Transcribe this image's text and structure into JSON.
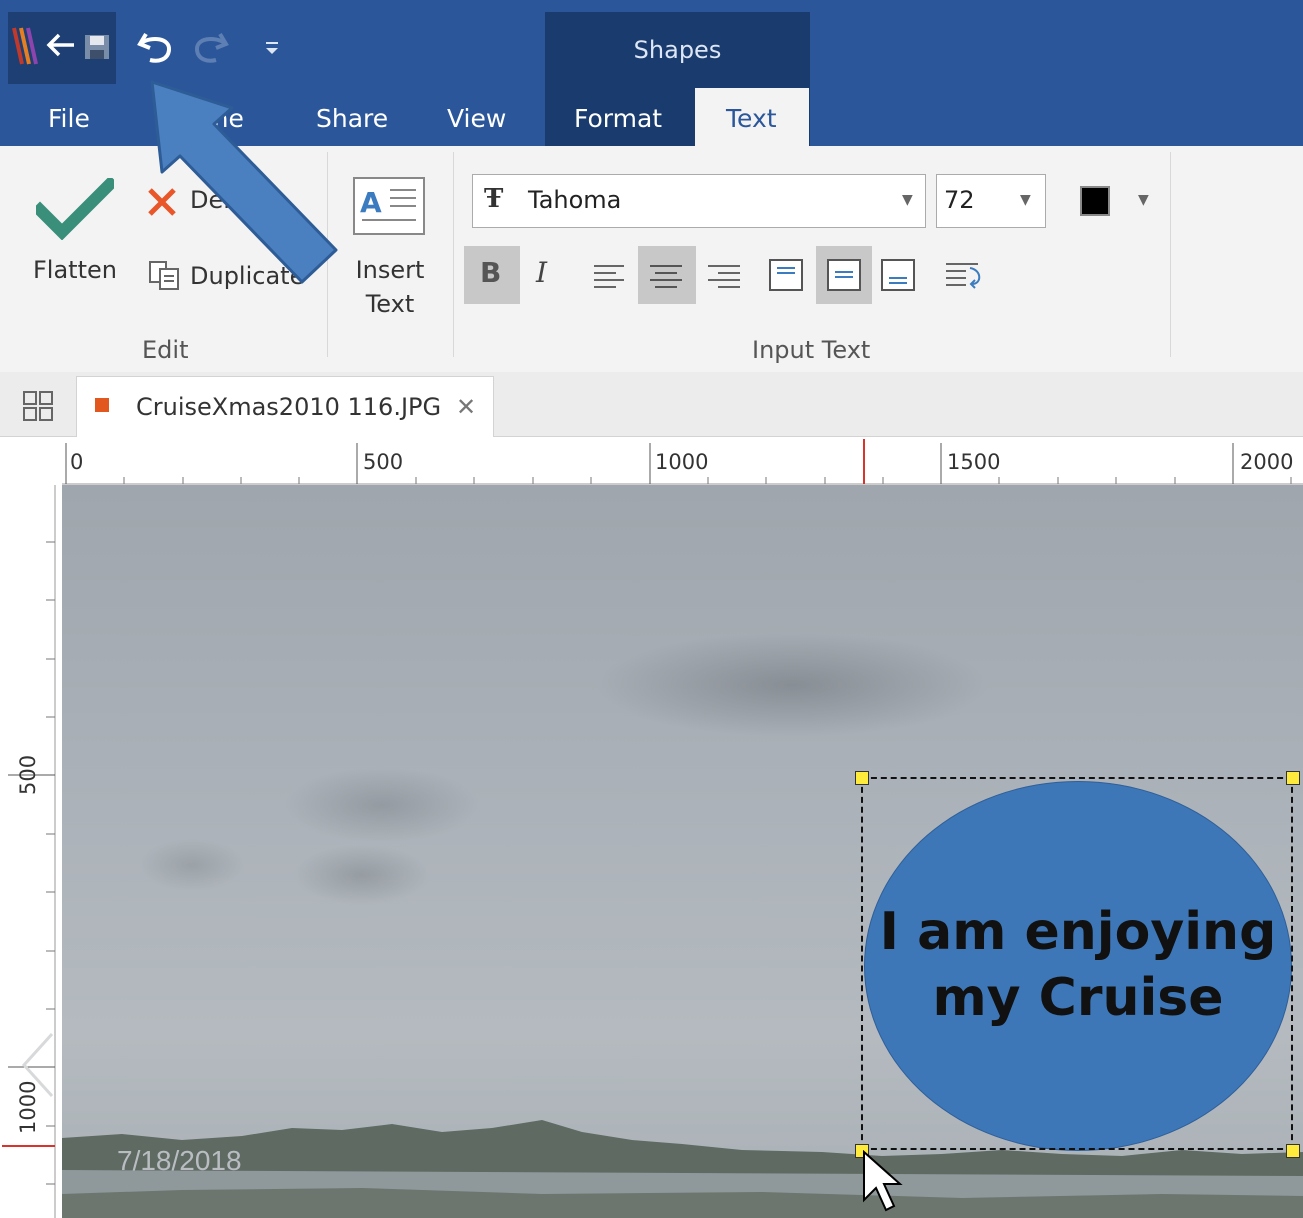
{
  "titlebar": {
    "contextual_group": "Shapes"
  },
  "tabs": {
    "file": "File",
    "home": "Home",
    "share": "Share",
    "view": "View",
    "format": "Format",
    "text": "Text"
  },
  "ribbon": {
    "edit": {
      "flatten": "Flatten",
      "delete": "Delete",
      "duplicate": "Duplicate",
      "group_label": "Edit"
    },
    "insert_text": {
      "line1": "Insert",
      "line2": "Text"
    },
    "input_text": {
      "font_name": "Tahoma",
      "font_size": "72",
      "bold": "B",
      "italic": "I",
      "group_label": "Input Text",
      "text_color": "#000000"
    }
  },
  "document_tab": {
    "title": "CruiseXmas2010 116.JPG",
    "close": "✕"
  },
  "rulers": {
    "horizontal": [
      "0",
      "500",
      "1000",
      "1500",
      "2000"
    ],
    "vertical": [
      "500",
      "1000"
    ]
  },
  "canvas": {
    "shape_text_line1": "I am enjoying",
    "shape_text_line2": "my Cruise",
    "shape_color": "#3d77b8",
    "date_footer": "7/18/2018"
  },
  "colors": {
    "accent": "#2b579a",
    "contextual": "#1a3b6e",
    "flatten_check": "#3a8f7a",
    "delete_x": "#e8562a",
    "doc_marker": "#e2571e",
    "handle": "#ffeb3b",
    "annotation_arrow": "#4a7fc0"
  },
  "icons": [
    "app-logo-icon",
    "back-arrow-icon",
    "save-icon",
    "undo-icon",
    "redo-icon",
    "customize-qat-icon",
    "check-icon",
    "delete-x-icon",
    "duplicate-icon",
    "insert-text-icon",
    "font-icon",
    "align-left-icon",
    "align-center-icon",
    "align-right-icon",
    "valign-top-icon",
    "valign-middle-icon",
    "valign-bottom-icon",
    "wrap-text-icon",
    "grid-view-icon",
    "close-icon",
    "mouse-cursor-icon"
  ]
}
